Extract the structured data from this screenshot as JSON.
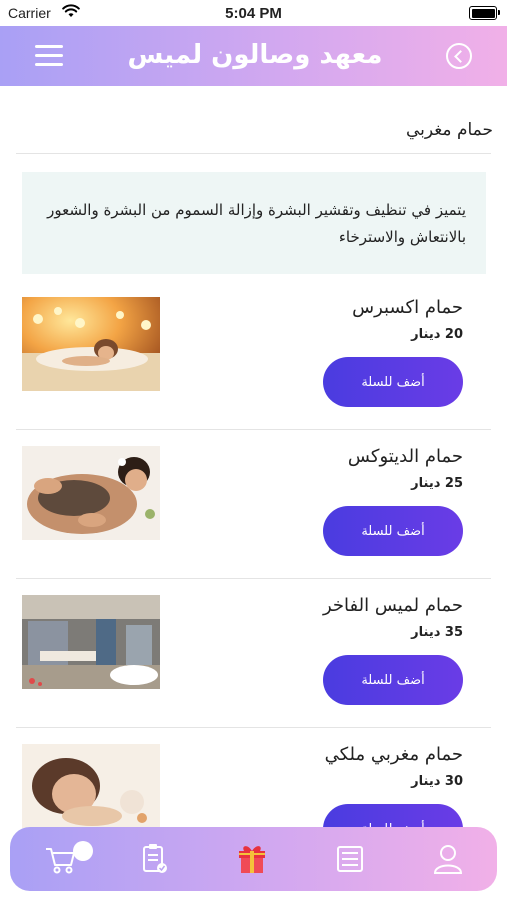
{
  "status_bar": {
    "carrier": "Carrier",
    "time": "5:04 PM"
  },
  "header": {
    "title": "معهد وصالون لميس"
  },
  "section": {
    "title": "حمام مغربي",
    "description": "يتميز في تنظيف وتقشير البشرة وإزالة السموم من البشرة والشعور بالانتعاش والاسترخاء"
  },
  "products": [
    {
      "name": "حمام اكسبرس",
      "price": "20 دينار",
      "button": "أضف للسلة",
      "image": "spa-candles-photo"
    },
    {
      "name": "حمام الديتوكس",
      "price": "25 دينار",
      "button": "أضف للسلة",
      "image": "mud-massage-photo"
    },
    {
      "name": "حمام لميس الفاخر",
      "price": "35 دينار",
      "button": "أضف للسلة",
      "image": "luxury-bath-room-photo"
    },
    {
      "name": "حمام مغربي ملكي",
      "price": "30 دينار",
      "button": "أضف للسلة",
      "image": "relaxing-woman-photo"
    }
  ],
  "tab_bar": {
    "icons": [
      "cart-icon",
      "orders-icon",
      "gift-icon",
      "menu-list-icon",
      "profile-icon"
    ],
    "active": "gift-icon"
  },
  "colors": {
    "header_gradient_start": "#a9a0f5",
    "header_gradient_end": "#f1b0e8",
    "button": "#4f3ce2",
    "description_bg": "#eef6f5",
    "gift_active": "#e8323f"
  }
}
